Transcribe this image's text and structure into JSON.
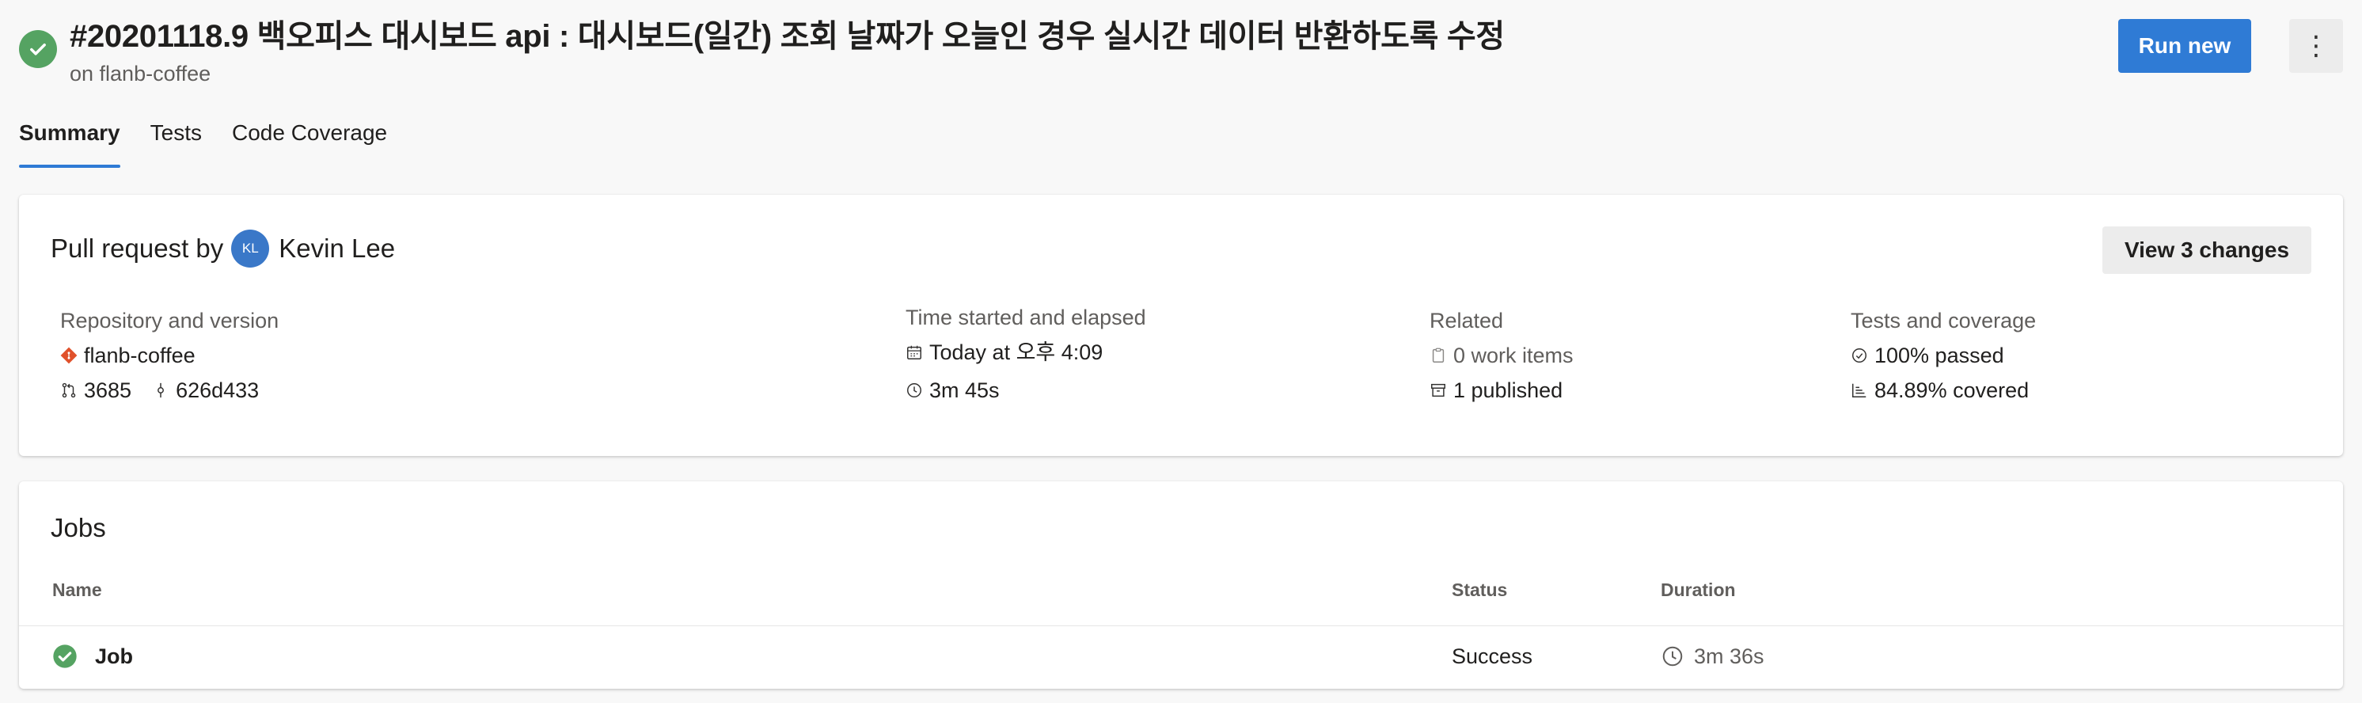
{
  "header": {
    "title": "#20201118.9 백오피스 대시보드 api : 대시보드(일간) 조회 날짜가 오늘인 경우 실시간 데이터 반환하도록 수정",
    "subtitle": "on flanb-coffee",
    "run_new_label": "Run new",
    "more_label": "⋮",
    "status_color": "#55a362",
    "accent_color": "#2f7bd5"
  },
  "tabs": [
    {
      "label": "Summary",
      "active": true
    },
    {
      "label": "Tests",
      "active": false
    },
    {
      "label": "Code Coverage",
      "active": false
    }
  ],
  "summary": {
    "pr_prefix": "Pull request by",
    "avatar_initials": "KL",
    "author": "Kevin Lee",
    "view_changes_label": "View 3 changes",
    "repo": {
      "label": "Repository and version",
      "name": "flanb-coffee",
      "pr_number": "3685",
      "commit": "626d433"
    },
    "time": {
      "label": "Time started and elapsed",
      "started": "Today at 오후 4:09",
      "elapsed": "3m 45s"
    },
    "related": {
      "label": "Related",
      "work_items": "0 work items",
      "published": "1 published"
    },
    "tests": {
      "label": "Tests and coverage",
      "passed": "100% passed",
      "covered": "84.89% covered"
    }
  },
  "jobs": {
    "title": "Jobs",
    "columns": {
      "name": "Name",
      "status": "Status",
      "duration": "Duration"
    },
    "rows": [
      {
        "name": "Job",
        "status": "Success",
        "duration": "3m 36s"
      }
    ]
  }
}
